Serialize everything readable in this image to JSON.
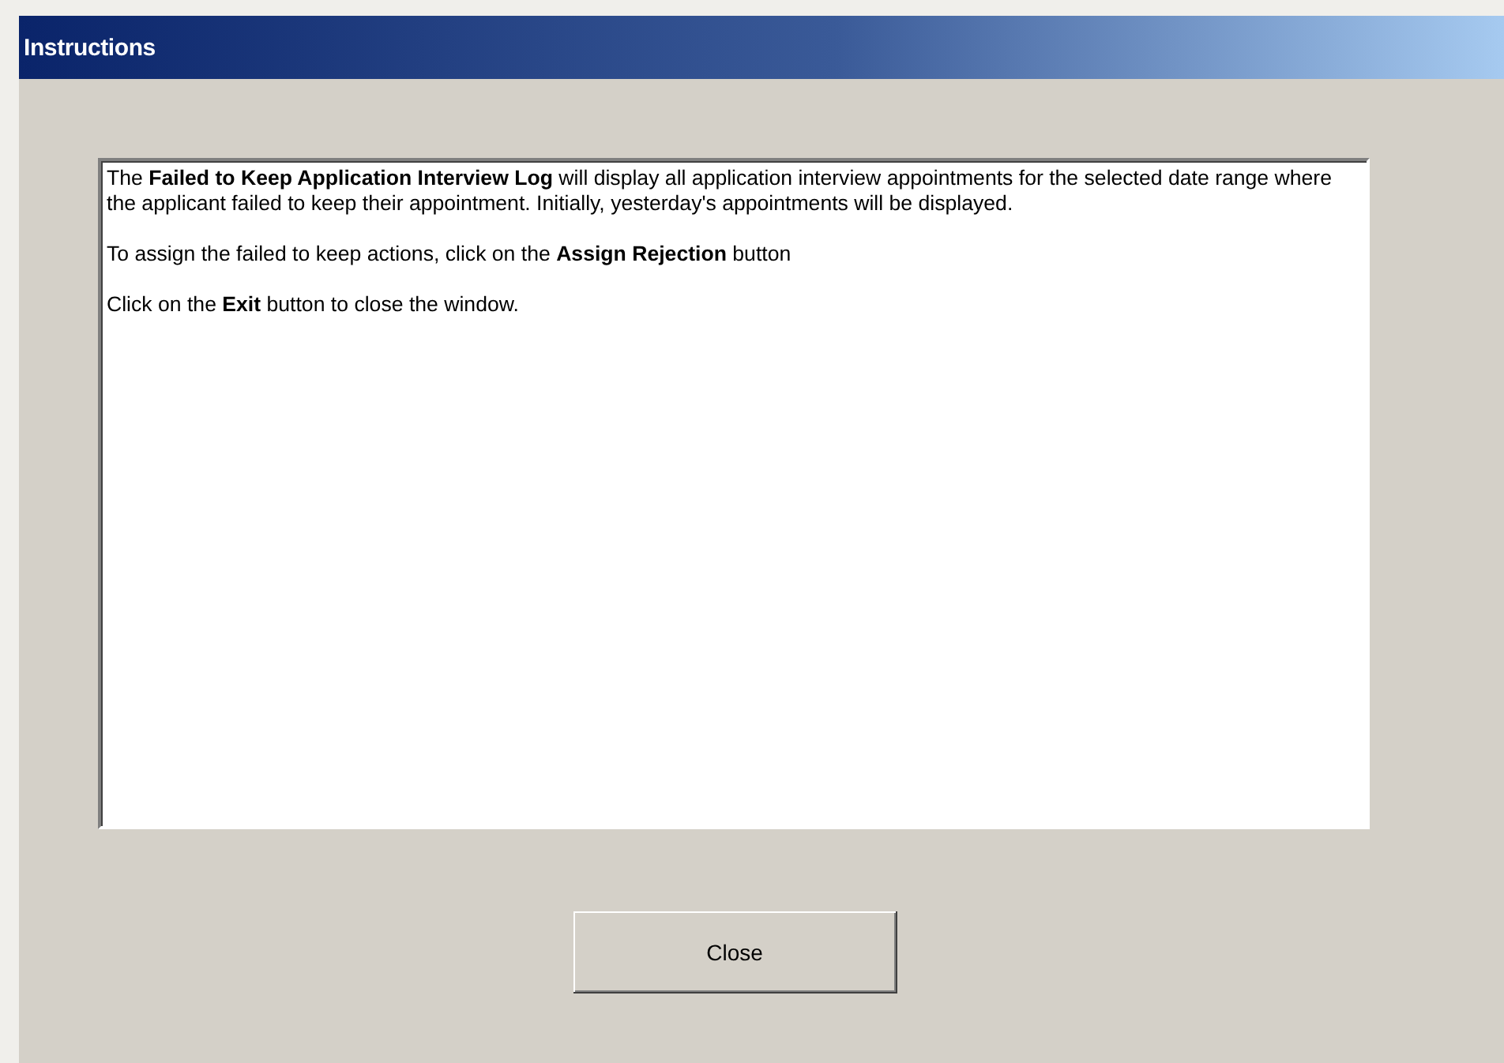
{
  "window": {
    "title": "Instructions"
  },
  "paragraphs": [
    "The **Failed to Keep Application Interview Log** will display all application interview appointments for the selected date range where the applicant failed to keep their appointment. Initially, yesterday's appointments will be displayed.",
    "To assign the failed to keep actions, click on the **Assign Rejection** button",
    "Click on the **Exit** button to close the window."
  ],
  "buttons": [
    "Close"
  ]
}
